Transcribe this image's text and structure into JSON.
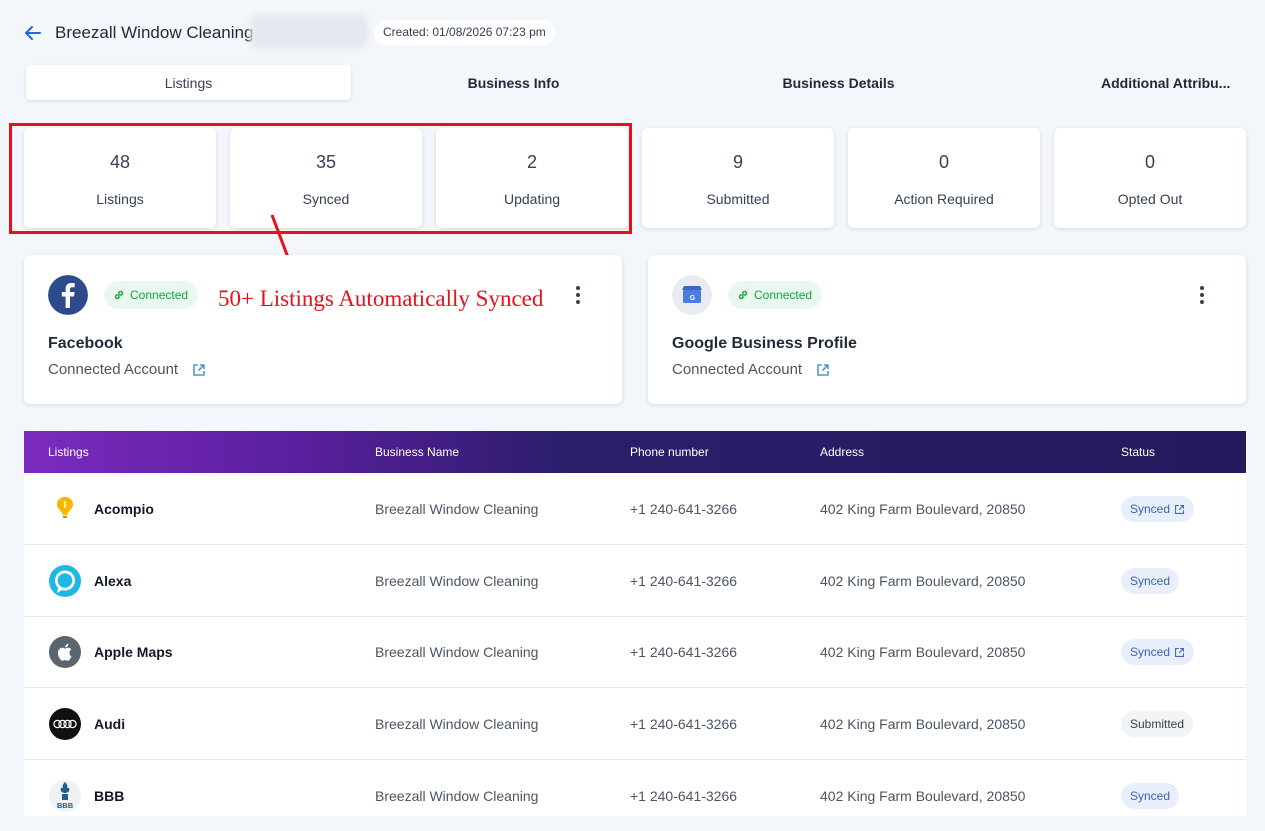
{
  "header": {
    "title": "Breezall Window Cleaning",
    "created": "Created: 01/08/2026 07:23 pm"
  },
  "tabs": [
    {
      "label": "Listings",
      "active": true
    },
    {
      "label": "Business Info",
      "active": false
    },
    {
      "label": "Business Details",
      "active": false
    },
    {
      "label": "Additional Attribu...",
      "active": false
    }
  ],
  "stats": [
    {
      "value": "48",
      "label": "Listings"
    },
    {
      "value": "35",
      "label": "Synced"
    },
    {
      "value": "2",
      "label": "Updating"
    },
    {
      "value": "9",
      "label": "Submitted"
    },
    {
      "value": "0",
      "label": "Action Required"
    },
    {
      "value": "0",
      "label": "Opted Out"
    }
  ],
  "annotation": "50+ Listings Automatically Synced",
  "accounts": [
    {
      "name": "Facebook",
      "status": "Connected",
      "sub": "Connected Account"
    },
    {
      "name": "Google Business Profile",
      "status": "Connected",
      "sub": "Connected Account"
    }
  ],
  "table": {
    "headers": [
      "Listings",
      "Business Name",
      "Phone number",
      "Address",
      "Status"
    ],
    "rows": [
      {
        "listing": "Acompio",
        "business": "Breezall Window Cleaning",
        "phone": "+1 240-641-3266",
        "address": "402 King Farm Boulevard, 20850",
        "status": "Synced"
      },
      {
        "listing": "Alexa",
        "business": "Breezall Window Cleaning",
        "phone": "+1 240-641-3266",
        "address": "402 King Farm Boulevard, 20850",
        "status": "Synced"
      },
      {
        "listing": "Apple Maps",
        "business": "Breezall Window Cleaning",
        "phone": "+1 240-641-3266",
        "address": "402 King Farm Boulevard, 20850",
        "status": "Synced"
      },
      {
        "listing": "Audi",
        "business": "Breezall Window Cleaning",
        "phone": "+1 240-641-3266",
        "address": "402 King Farm Boulevard, 20850",
        "status": "Submitted"
      },
      {
        "listing": "BBB",
        "business": "Breezall Window Cleaning",
        "phone": "+1 240-641-3266",
        "address": "402 King Farm Boulevard, 20850",
        "status": "Synced"
      }
    ]
  },
  "colors": {
    "accent": "#2563eb",
    "annotation_red": "#e8101a",
    "connected_green": "#16a34a",
    "synced_blue": "#3b64b5",
    "header_purple": "#7b2bbf",
    "header_navy": "#241b5e"
  },
  "icons": {
    "back": "arrow-left-icon",
    "link": "link-icon",
    "external": "external-link-icon",
    "kebab": "kebab-menu-icon"
  }
}
